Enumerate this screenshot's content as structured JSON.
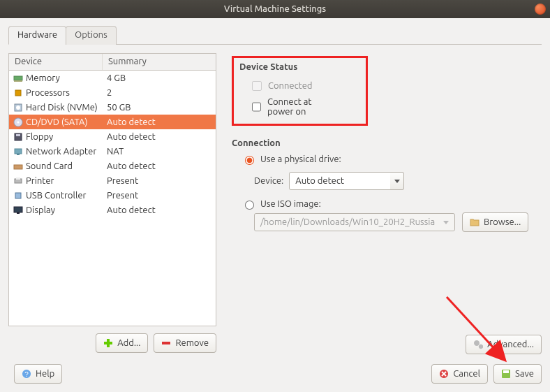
{
  "window": {
    "title": "Virtual Machine Settings"
  },
  "tabs": {
    "hardware": "Hardware",
    "options": "Options"
  },
  "table": {
    "head_device": "Device",
    "head_summary": "Summary",
    "rows": [
      {
        "icon": "memory",
        "dev": "Memory",
        "sum": "4 GB"
      },
      {
        "icon": "cpu",
        "dev": "Processors",
        "sum": "2"
      },
      {
        "icon": "disk",
        "dev": "Hard Disk (NVMe)",
        "sum": "50 GB"
      },
      {
        "icon": "cd",
        "dev": "CD/DVD (SATA)",
        "sum": "Auto detect"
      },
      {
        "icon": "floppy",
        "dev": "Floppy",
        "sum": "Auto detect"
      },
      {
        "icon": "net",
        "dev": "Network Adapter",
        "sum": "NAT"
      },
      {
        "icon": "sound",
        "dev": "Sound Card",
        "sum": "Auto detect"
      },
      {
        "icon": "printer",
        "dev": "Printer",
        "sum": "Present"
      },
      {
        "icon": "usb",
        "dev": "USB Controller",
        "sum": "Present"
      },
      {
        "icon": "display",
        "dev": "Display",
        "sum": "Auto detect"
      }
    ],
    "selected_index": 3
  },
  "left_buttons": {
    "add": "Add...",
    "remove": "Remove"
  },
  "status": {
    "title": "Device Status",
    "connected": "Connected",
    "connect_on_power": "Connect at power on"
  },
  "connection": {
    "title": "Connection",
    "physical": "Use a physical drive:",
    "device_label": "Device:",
    "device_value": "Auto detect",
    "iso": "Use ISO image:",
    "iso_path": "/home/lin/Downloads/Win10_20H2_Russia",
    "browse": "Browse..."
  },
  "advanced": "Advanced...",
  "dialog": {
    "help": "Help",
    "cancel": "Cancel",
    "save": "Save"
  }
}
